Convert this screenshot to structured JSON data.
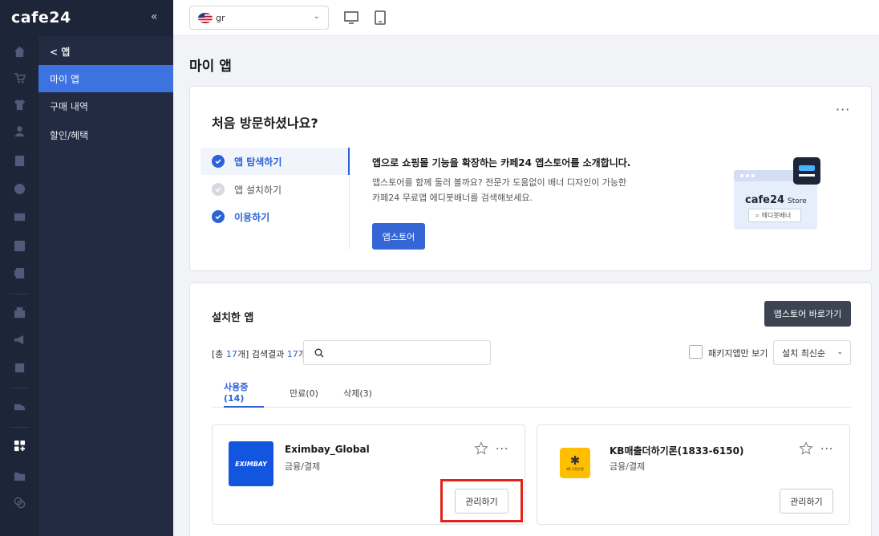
{
  "brand": {
    "logo": "cafe24"
  },
  "sidebar": {
    "back_label": "< 앱",
    "items": [
      {
        "label": "마이 앱",
        "active": true
      },
      {
        "label": "구매 내역",
        "active": false
      },
      {
        "label": "할인/혜택",
        "active": false
      }
    ],
    "rail_icons": [
      "home-icon",
      "cart-icon",
      "shirt-icon",
      "user-icon",
      "board-icon",
      "palette-icon",
      "promo-icon",
      "stats-icon",
      "excel-icon",
      "store-icon",
      "megaphone-icon",
      "receipt-icon",
      "truck-icon",
      "apps-icon",
      "folder-icon",
      "copy-icon"
    ]
  },
  "topbar": {
    "language_value": "gr",
    "device_icons": [
      "desktop-icon",
      "mobile-icon"
    ]
  },
  "page": {
    "title": "마이 앱"
  },
  "welcome": {
    "title": "처음 방문하셨나요?",
    "steps": [
      {
        "label": "앱 탐색하기",
        "state": "active"
      },
      {
        "label": "앱 설치하기",
        "state": "pending"
      },
      {
        "label": "이용하기",
        "state": "done"
      }
    ],
    "heading": "앱으로 쇼핑몰 기능을 확장하는 카페24 앱스토어를 소개합니다.",
    "desc_line1": "앱스토어를 함께 둘러 볼까요? 전문가 도움없이 배너 디자인이 가능한",
    "desc_line2": "카페24 무료앱 에디봇배너를 검색해보세요.",
    "button": "앱스토어",
    "illus_brand": "cafe24",
    "illus_store": "Store",
    "illus_search": "에디봇배너"
  },
  "installed": {
    "title": "설치한 앱",
    "go_store_button": "앱스토어 바로가기",
    "result_prefix": "[총 ",
    "total_count": "17",
    "result_mid": "개] 검색결과 ",
    "result_count": "17",
    "result_suffix": "개",
    "search_placeholder": "",
    "package_only_label": "패키지앱만 보기",
    "sort_value": "설치 최신순",
    "tabs": [
      {
        "label": "사용중(14)",
        "active": true
      },
      {
        "label": "만료(0)",
        "active": false
      },
      {
        "label": "삭제(3)",
        "active": false
      }
    ],
    "apps": [
      {
        "name": "Eximbay_Global",
        "category": "금융/결제",
        "manage_label": "관리하기",
        "logo_text": "EXIMBAY",
        "logo_color": "#1256e0",
        "highlighted": true
      },
      {
        "name": "KB매출더하기론(1833-6150)",
        "category": "금융/결제",
        "manage_label": "관리하기",
        "logo_text": "KB 국민은행",
        "logo_color": "#ffbf00",
        "highlighted": false
      }
    ]
  },
  "colors": {
    "accent": "#3466d6",
    "highlight": "#e2231a",
    "sidebar_bg": "#222b42",
    "rail_bg": "#1d2538"
  }
}
